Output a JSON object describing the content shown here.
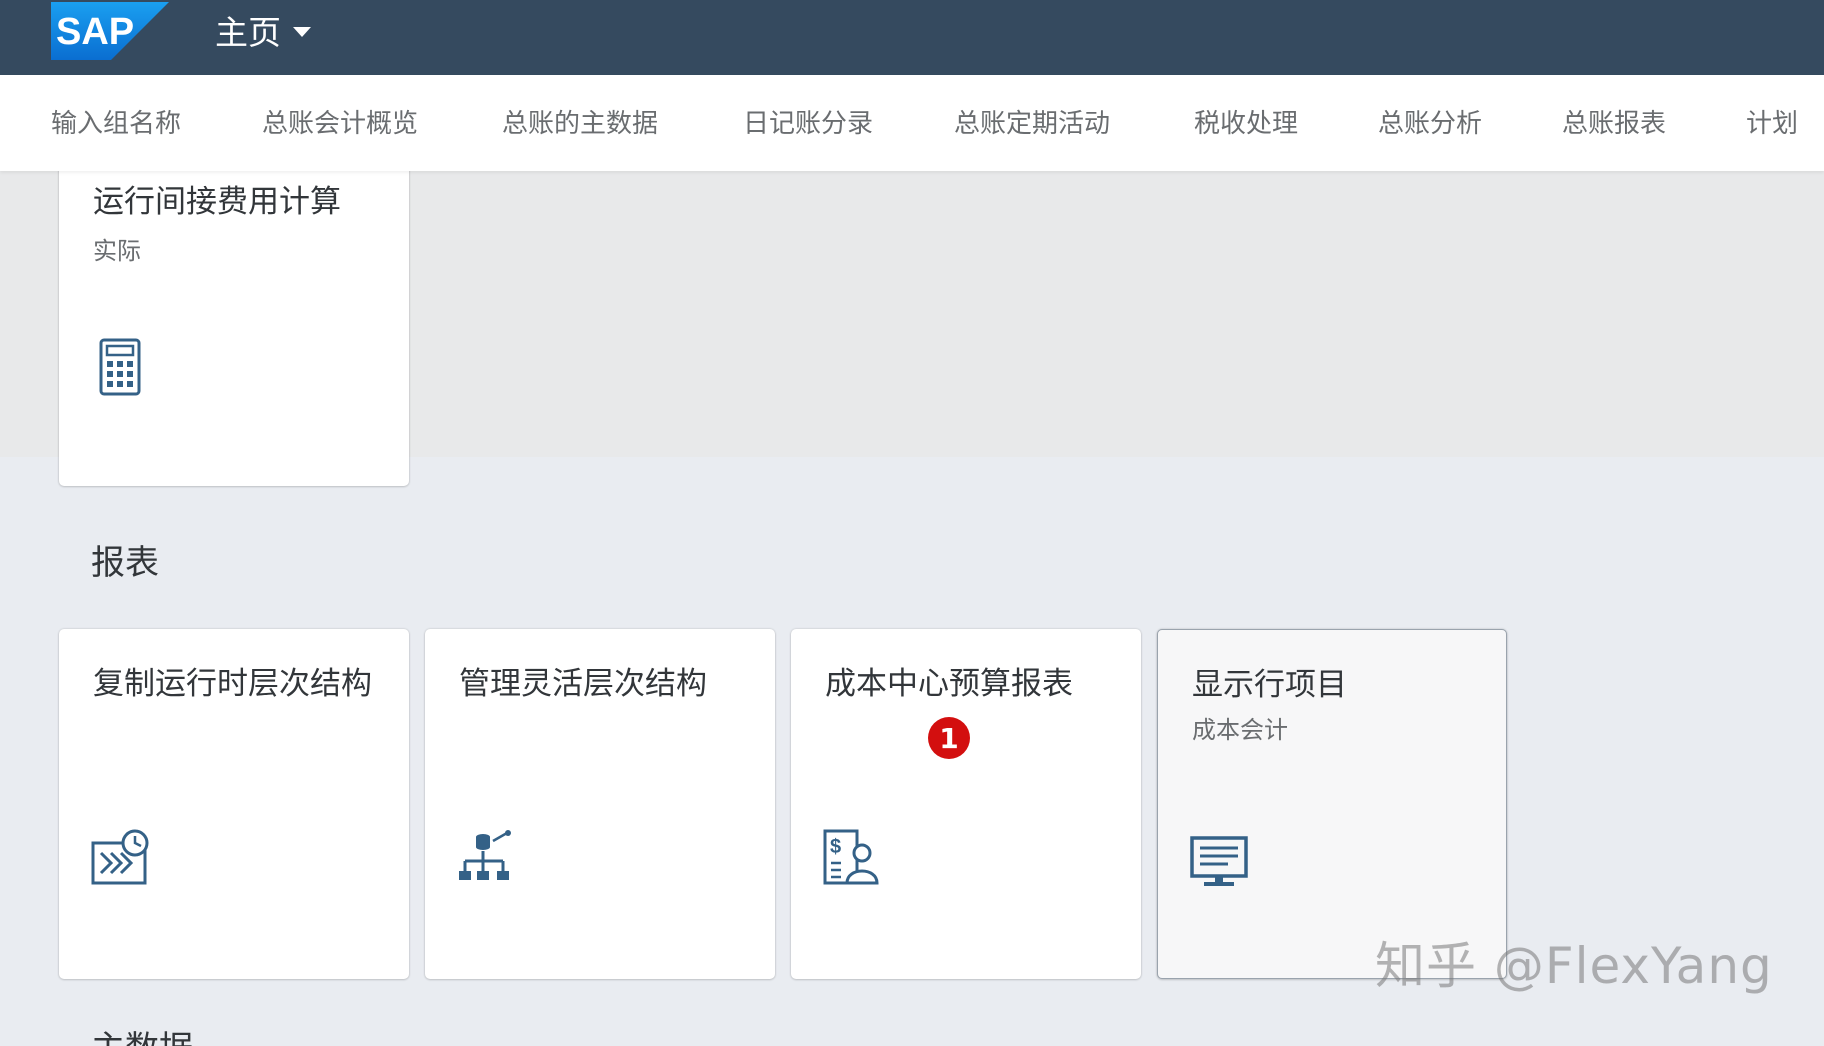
{
  "shell": {
    "logo_text": "SAP",
    "home_title": "主页"
  },
  "anchor_nav": [
    {
      "label": "输入组名称"
    },
    {
      "label": "总账会计概览"
    },
    {
      "label": "总账的主数据"
    },
    {
      "label": "日记账分录"
    },
    {
      "label": "总账定期活动"
    },
    {
      "label": "税收处理"
    },
    {
      "label": "总账分析"
    },
    {
      "label": "总账报表"
    },
    {
      "label": "计划"
    }
  ],
  "tiles_top": [
    {
      "title": "运行间接费用计算",
      "subtitle": "实际",
      "icon": "calculator-icon"
    }
  ],
  "sections": [
    {
      "title": "报表"
    },
    {
      "title": "主数据"
    }
  ],
  "tiles_reports": [
    {
      "title": "复制运行时层次结构",
      "subtitle": "",
      "icon": "copy-runtime-hierarchy-icon"
    },
    {
      "title": "管理灵活层次结构",
      "subtitle": "",
      "icon": "hierarchy-org-icon"
    },
    {
      "title": "成本中心预算报表",
      "subtitle": "",
      "icon": "budget-person-icon"
    },
    {
      "title": "显示行项目",
      "subtitle": "成本会计",
      "icon": "monitor-icon"
    }
  ],
  "annotation_badge": "1",
  "watermark": "知乎 @FlexYang",
  "colors": {
    "shell_bg": "#354a5f",
    "icon_blue": "#346187",
    "badge_red": "#d30f0f"
  }
}
